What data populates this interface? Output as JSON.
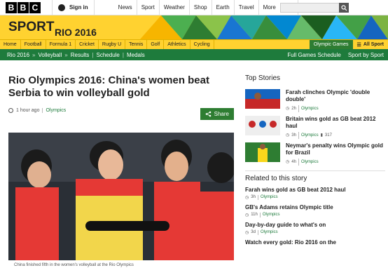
{
  "topbar": {
    "logo_letters": [
      "B",
      "B",
      "C"
    ],
    "signin_label": "Sign in",
    "nav": [
      "News",
      "Sport",
      "Weather",
      "Shop",
      "Earth",
      "Travel",
      "More"
    ],
    "more_chevron": "▾",
    "search_icon": "search-icon"
  },
  "sport_header": {
    "title": "SPORT",
    "subtitle": "RIO 2016"
  },
  "section_nav": {
    "items": [
      "Home",
      "Football",
      "Formula 1",
      "Cricket",
      "Rugby U",
      "Tennis",
      "Golf",
      "Athletics",
      "Cycling"
    ],
    "olympic_label": "Olympic Games",
    "all_sport_label": "All Sport"
  },
  "green_bar": {
    "crumb1": "Rio 2016",
    "crumb2": "Volleyball",
    "crumb_sep": "»",
    "links": [
      "Results",
      "Schedule",
      "Medals"
    ],
    "right_links": [
      "Full Games Schedule",
      "Sport by Sport"
    ]
  },
  "article": {
    "headline": "Rio Olympics 2016: China's women beat Serbia to win volleyball gold",
    "time": "1 hour ago",
    "category": "Olympics",
    "share_label": "Share",
    "caption": "China finished fifth in the women's volleyball at the Rio Olympics"
  },
  "top_stories": {
    "title": "Top Stories",
    "items": [
      {
        "headline": "Farah clinches Olympic 'double double'",
        "time": "2h",
        "category": "Olympics"
      },
      {
        "headline": "Britain wins gold as GB beat 2012 haul",
        "time": "3h",
        "category": "Olympics",
        "comments": "317"
      },
      {
        "headline": "Neymar's penalty wins Olympic gold for Brazil",
        "time": "4h",
        "category": "Olympics"
      }
    ]
  },
  "related": {
    "title": "Related to this story",
    "items": [
      {
        "headline": "Farah wins gold as GB beat 2012 haul",
        "time": "3h",
        "category": "Olympics"
      },
      {
        "headline": "GB's Adams retains Olympic title",
        "time": "11h",
        "category": "Olympics"
      },
      {
        "headline": "Day-by-day guide to what's on",
        "time": "3d",
        "category": "Olympics"
      },
      {
        "headline": "Watch every gold: Rio 2016 on the"
      }
    ]
  }
}
